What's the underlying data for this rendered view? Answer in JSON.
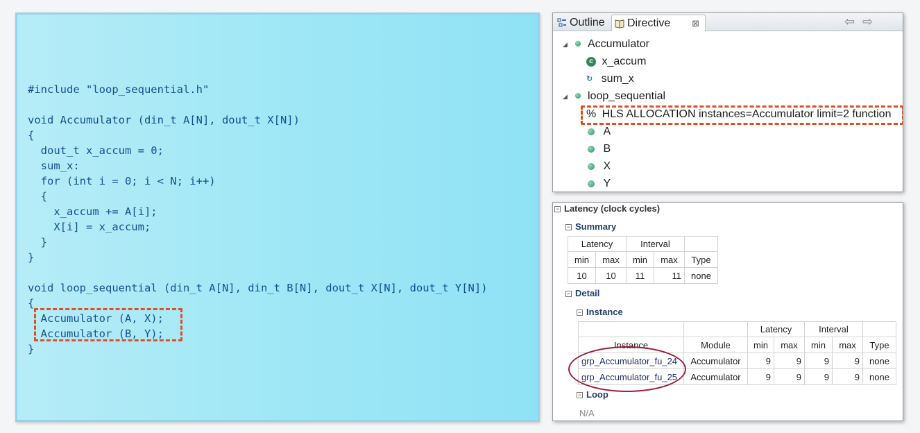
{
  "code": {
    "lines": [
      "#include \"loop_sequential.h\"",
      "void Accumulator (din_t A[N], dout_t X[N])",
      "{",
      "  dout_t x_accum = 0;",
      "  sum_x:",
      "  for (int i = 0; i < N; i++)",
      "  {",
      "    x_accum += A[i];",
      "    X[i] = x_accum;",
      "  }",
      "}",
      "void loop_sequential (din_t A[N], din_t B[N], dout_t X[N], dout_t Y[N])",
      "{",
      "  Accumulator (A, X);",
      "  Accumulator (B, Y);",
      "}"
    ]
  },
  "directive_panel": {
    "tabs": [
      "Outline",
      "Directive"
    ],
    "tab_close": "⊠",
    "nav_back": "⇦",
    "nav_forward": "⇨",
    "tree": {
      "accumulator": "Accumulator",
      "x_accum": "x_accum",
      "sum_x": "sum_x",
      "loop_sequential": "loop_sequential",
      "directive_symbol": "%",
      "directive": "HLS ALLOCATION instances=Accumulator limit=2 function",
      "ports": [
        "A",
        "B",
        "X",
        "Y"
      ]
    }
  },
  "latency_panel": {
    "title": "Latency (clock cycles)",
    "summary_title": "Summary",
    "summary": {
      "group_headers": [
        "Latency",
        "Interval"
      ],
      "columns": [
        "min",
        "max",
        "min",
        "max",
        "Type"
      ],
      "row": [
        "10",
        "10",
        "11",
        "11",
        "none"
      ]
    },
    "detail_title": "Detail",
    "instance_title": "Instance",
    "instance_table": {
      "group_headers": [
        "Latency",
        "Interval"
      ],
      "columns": [
        "Instance",
        "Module",
        "min",
        "max",
        "min",
        "max",
        "Type"
      ],
      "rows": [
        [
          "grp_Accumulator_fu_24",
          "Accumulator",
          "9",
          "9",
          "9",
          "9",
          "none"
        ],
        [
          "grp_Accumulator_fu_25",
          "Accumulator",
          "9",
          "9",
          "9",
          "9",
          "none"
        ]
      ]
    },
    "loop_title": "Loop",
    "loop_value": "N/A"
  }
}
